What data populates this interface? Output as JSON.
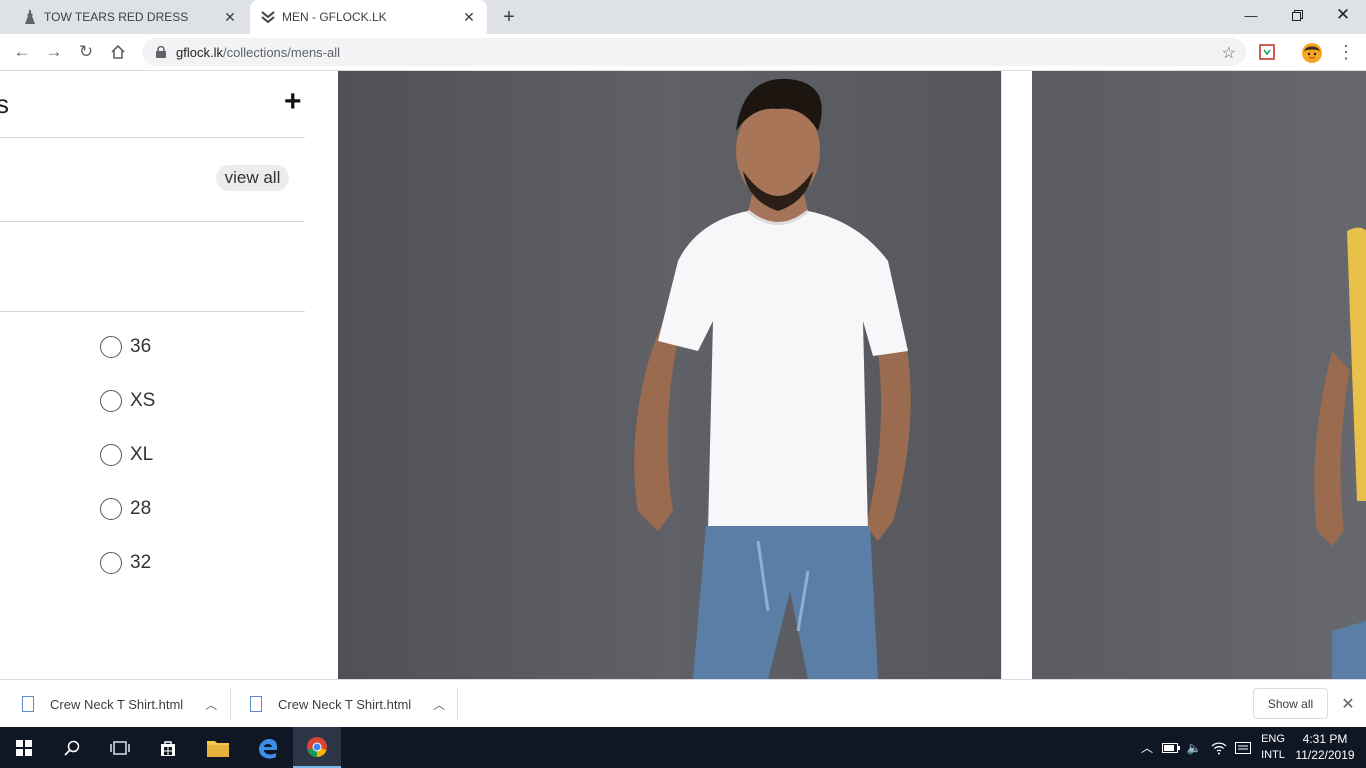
{
  "browser": {
    "tabs": [
      {
        "title": "TOW TEARS RED DRESS",
        "favicon": "dress-icon"
      },
      {
        "title": "MEN - GFLOCK.LK",
        "favicon": "gflock-chevron-icon",
        "active": true
      }
    ],
    "url_domain": "gflock.lk",
    "url_path": "/collections/mens-all"
  },
  "filter": {
    "title_fragment": "s",
    "view_all_label": "view all",
    "sizes": [
      {
        "label": "36",
        "checked": false
      },
      {
        "label": "XS",
        "checked": false
      },
      {
        "label": "XL",
        "checked": false
      },
      {
        "label": "28",
        "checked": false
      },
      {
        "label": "32",
        "checked": false
      }
    ]
  },
  "downloads": {
    "items": [
      {
        "name": "Crew Neck T Shirt.html"
      },
      {
        "name": "Crew Neck T Shirt.html"
      }
    ],
    "show_all_label": "Show all"
  },
  "taskbar": {
    "language_top": "ENG",
    "language_bottom": "INTL",
    "time": "4:31 PM",
    "date": "11/22/2019"
  }
}
